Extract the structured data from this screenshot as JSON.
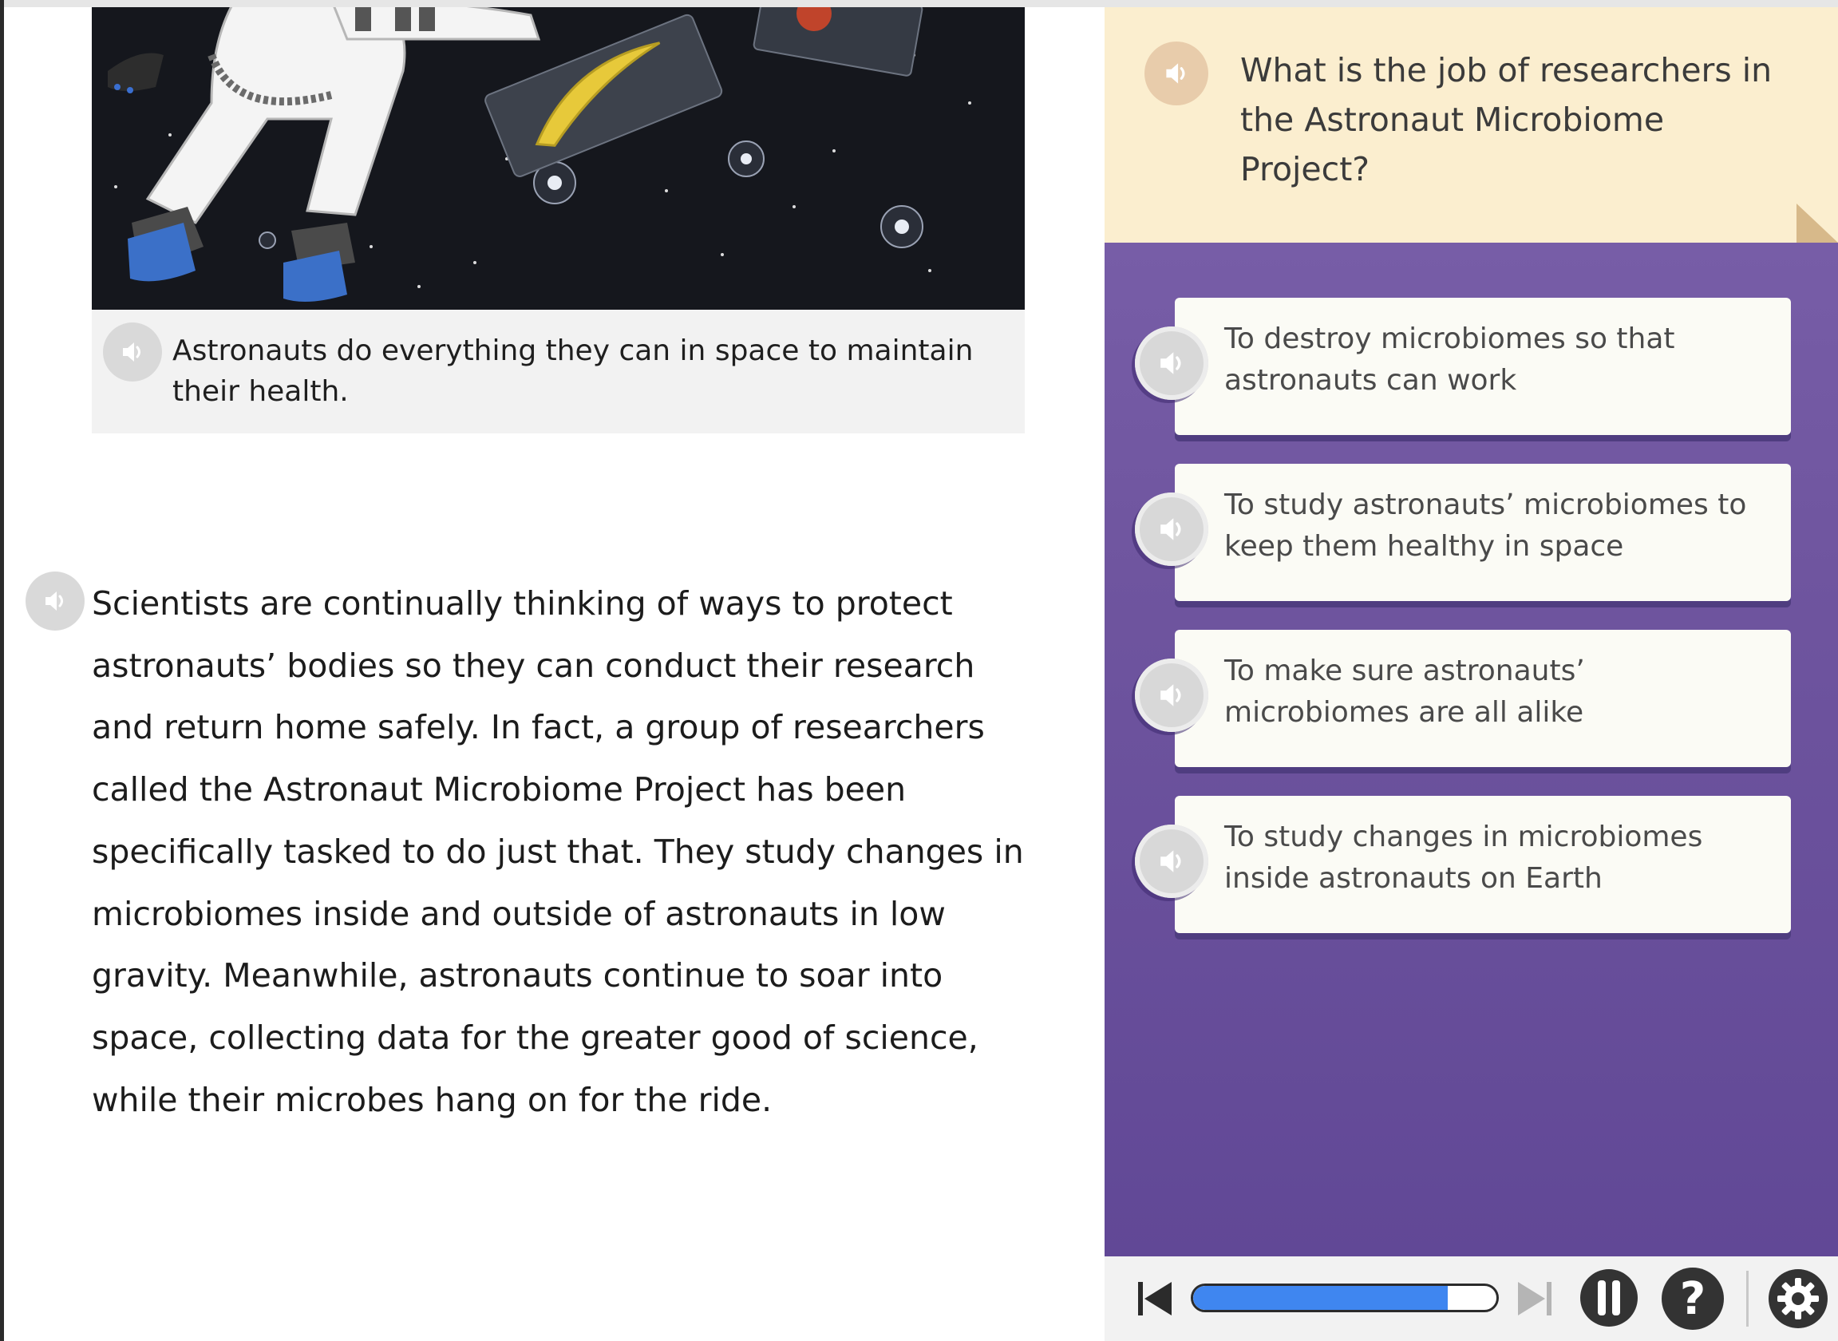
{
  "caption": {
    "text": "Astronauts do everything they can in space to maintain their health."
  },
  "paragraph": {
    "text": "Scientists are continually thinking of ways to protect astronauts’ bodies so they can conduct their research and return home safely. In fact, a group of researchers called the Astronaut Microbiome Project has been specifically tasked to do just that. They study changes in microbiomes inside and outside of astronauts in low gravity. Meanwhile, astronauts continue to soar into space, collecting data for the greater good of science, while their microbes hang on for the ride."
  },
  "question": {
    "text": "What is the job of researchers in the Astronaut Microbiome Project?"
  },
  "choices": [
    {
      "text": "To destroy microbiomes so that astronauts can work"
    },
    {
      "text": "To study astronauts’ microbiomes to keep them healthy in space"
    },
    {
      "text": "To make sure astronauts’ microbiomes are all alike"
    },
    {
      "text": "To study changes in microbiomes inside astronauts on Earth"
    }
  ],
  "toolbar": {
    "progress_fraction": 0.84
  },
  "icons": {
    "speaker": "speaker-icon",
    "back": "skip-back-icon",
    "forward": "skip-forward-icon",
    "pause": "pause-icon",
    "help": "help-icon",
    "settings": "gear-icon"
  },
  "colors": {
    "panel": "#6f559f",
    "question_bg": "#fbeecf",
    "choice_bg": "#fbfbf5",
    "progress": "#3f86f0"
  }
}
